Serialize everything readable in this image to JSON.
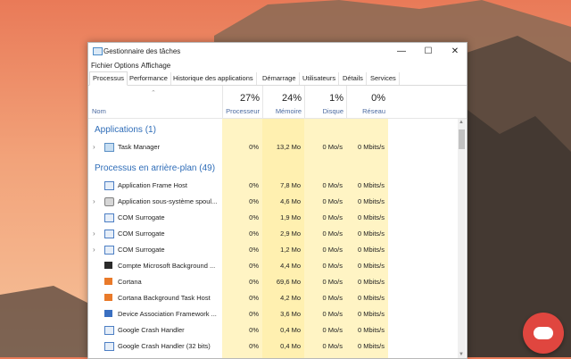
{
  "window": {
    "title": "Gestionnaire des tâches",
    "controls": {
      "minimize": "—",
      "maximize": "☐",
      "close": "✕"
    }
  },
  "menu": [
    "Fichier",
    "Options",
    "Affichage"
  ],
  "tabs": [
    "Processus",
    "Performance",
    "Historique des applications",
    "Démarrage",
    "Utilisateurs",
    "Détails",
    "Services"
  ],
  "active_tab": "Processus",
  "columns": {
    "name": "Nom",
    "cpu": {
      "pct": "27%",
      "label": "Processeur"
    },
    "memory": {
      "pct": "24%",
      "label": "Mémoire"
    },
    "disk": {
      "pct": "1%",
      "label": "Disque"
    },
    "network": {
      "pct": "0%",
      "label": "Réseau"
    }
  },
  "groups": {
    "apps": "Applications (1)",
    "background": "Processus en arrière-plan (49)"
  },
  "apps": [
    {
      "name": "Task Manager",
      "icon": "task-manager-icon",
      "expand": true,
      "cpu": "0%",
      "mem": "13,2 Mo",
      "disk": "0 Mo/s",
      "net": "0 Mbits/s"
    }
  ],
  "background": [
    {
      "name": "Application Frame Host",
      "icon": "window-icon",
      "expand": false,
      "cpu": "0%",
      "mem": "7,8 Mo",
      "disk": "0 Mo/s",
      "net": "0 Mbits/s"
    },
    {
      "name": "Application sous-système spoul...",
      "icon": "printer-icon",
      "expand": true,
      "cpu": "0%",
      "mem": "4,6 Mo",
      "disk": "0 Mo/s",
      "net": "0 Mbits/s"
    },
    {
      "name": "COM Surrogate",
      "icon": "window-icon",
      "expand": false,
      "cpu": "0%",
      "mem": "1,9 Mo",
      "disk": "0 Mo/s",
      "net": "0 Mbits/s"
    },
    {
      "name": "COM Surrogate",
      "icon": "window-icon",
      "expand": true,
      "cpu": "0%",
      "mem": "2,9 Mo",
      "disk": "0 Mo/s",
      "net": "0 Mbits/s"
    },
    {
      "name": "COM Surrogate",
      "icon": "window-icon",
      "expand": true,
      "cpu": "0%",
      "mem": "1,2 Mo",
      "disk": "0 Mo/s",
      "net": "0 Mbits/s"
    },
    {
      "name": "Compte Microsoft Background ...",
      "icon": "microsoft-icon",
      "expand": false,
      "cpu": "0%",
      "mem": "4,4 Mo",
      "disk": "0 Mo/s",
      "net": "0 Mbits/s"
    },
    {
      "name": "Cortana",
      "icon": "cortana-icon",
      "expand": false,
      "cpu": "0%",
      "mem": "69,6 Mo",
      "disk": "0 Mo/s",
      "net": "0 Mbits/s"
    },
    {
      "name": "Cortana Background Task Host",
      "icon": "cortana-icon",
      "expand": false,
      "cpu": "0%",
      "mem": "4,2 Mo",
      "disk": "0 Mo/s",
      "net": "0 Mbits/s"
    },
    {
      "name": "Device Association Framework ...",
      "icon": "device-icon",
      "expand": false,
      "cpu": "0%",
      "mem": "3,6 Mo",
      "disk": "0 Mo/s",
      "net": "0 Mbits/s"
    },
    {
      "name": "Google Crash Handler",
      "icon": "window-icon",
      "expand": false,
      "cpu": "0%",
      "mem": "0,4 Mo",
      "disk": "0 Mo/s",
      "net": "0 Mbits/s"
    },
    {
      "name": "Google Crash Handler (32 bits)",
      "icon": "window-icon",
      "expand": false,
      "cpu": "0%",
      "mem": "0,4 Mo",
      "disk": "0 Mo/s",
      "net": "0 Mbits/s"
    }
  ]
}
